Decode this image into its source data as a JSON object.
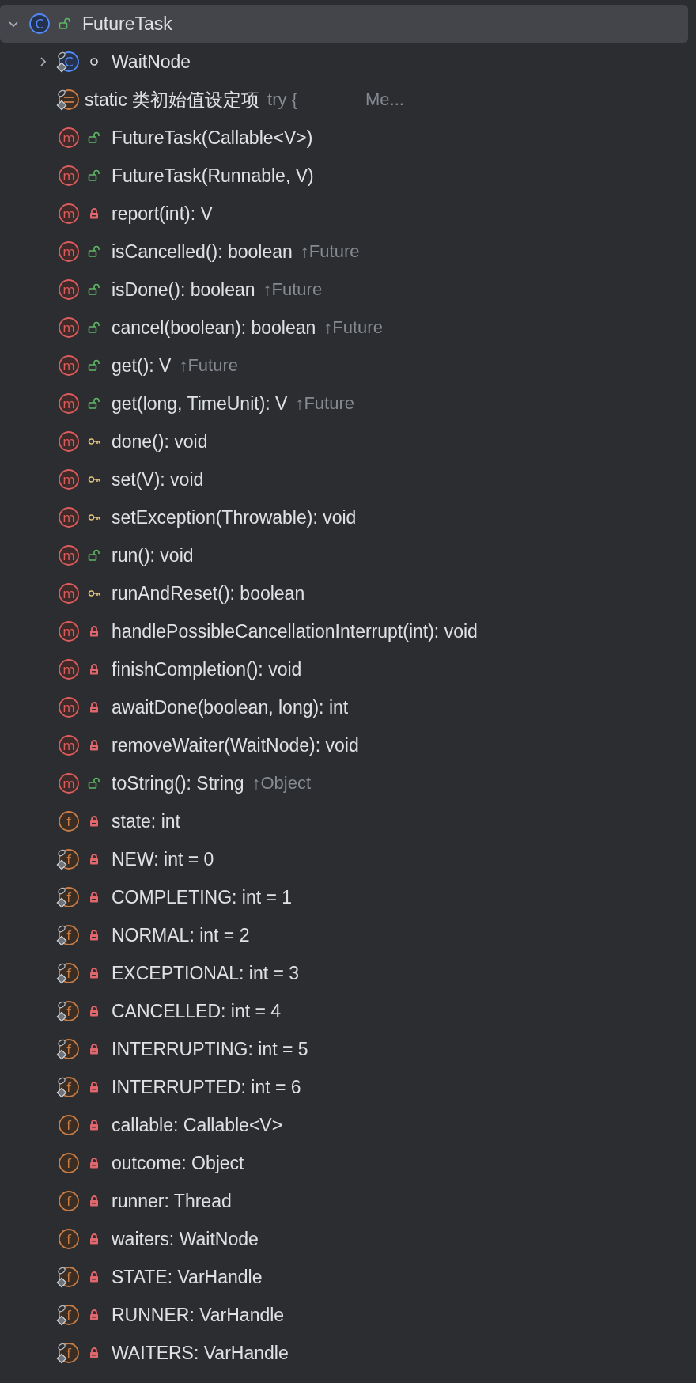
{
  "tree": {
    "name": "FutureTask",
    "kind": "class",
    "badge": "C",
    "modifier": {
      "kind": "public"
    },
    "expanded": true,
    "selected": true,
    "children": [
      {
        "name": "WaitNode",
        "kind": "class",
        "badge": "C",
        "modifier": {
          "kind": "package"
        },
        "static": true,
        "expanded": false,
        "selected": false
      },
      {
        "name": "static 类初始值设定项",
        "kind": "initializer",
        "static": true,
        "selected": false,
        "hint": "try {",
        "hint_2": "Me..."
      },
      {
        "name": "FutureTask(Callable<V>)",
        "kind": "method",
        "badge": "m",
        "modifier": {
          "kind": "public"
        },
        "selected": false
      },
      {
        "name": "FutureTask(Runnable, V)",
        "kind": "method",
        "badge": "m",
        "modifier": {
          "kind": "public"
        },
        "selected": false
      },
      {
        "name": "report(int): V",
        "kind": "method",
        "badge": "m",
        "modifier": {
          "kind": "private"
        },
        "selected": false
      },
      {
        "name": "isCancelled(): boolean",
        "kind": "method",
        "badge": "m",
        "modifier": {
          "kind": "public"
        },
        "selected": false,
        "hint": "↑Future"
      },
      {
        "name": "isDone(): boolean",
        "kind": "method",
        "badge": "m",
        "modifier": {
          "kind": "public"
        },
        "selected": false,
        "hint": "↑Future"
      },
      {
        "name": "cancel(boolean): boolean",
        "kind": "method",
        "badge": "m",
        "modifier": {
          "kind": "public"
        },
        "selected": false,
        "hint": "↑Future"
      },
      {
        "name": "get(): V",
        "kind": "method",
        "badge": "m",
        "modifier": {
          "kind": "public"
        },
        "selected": false,
        "hint": "↑Future"
      },
      {
        "name": "get(long, TimeUnit): V",
        "kind": "method",
        "badge": "m",
        "modifier": {
          "kind": "public"
        },
        "selected": false,
        "hint": "↑Future"
      },
      {
        "name": "done(): void",
        "kind": "method",
        "badge": "m",
        "modifier": {
          "kind": "protected"
        },
        "selected": false
      },
      {
        "name": "set(V): void",
        "kind": "method",
        "badge": "m",
        "modifier": {
          "kind": "protected"
        },
        "selected": false
      },
      {
        "name": "setException(Throwable): void",
        "kind": "method",
        "badge": "m",
        "modifier": {
          "kind": "protected"
        },
        "selected": false
      },
      {
        "name": "run(): void",
        "kind": "method",
        "badge": "m",
        "modifier": {
          "kind": "public"
        },
        "selected": false
      },
      {
        "name": "runAndReset(): boolean",
        "kind": "method",
        "badge": "m",
        "modifier": {
          "kind": "protected"
        },
        "selected": false
      },
      {
        "name": "handlePossibleCancellationInterrupt(int): void",
        "kind": "method",
        "badge": "m",
        "modifier": {
          "kind": "private"
        },
        "selected": false
      },
      {
        "name": "finishCompletion(): void",
        "kind": "method",
        "badge": "m",
        "modifier": {
          "kind": "private"
        },
        "selected": false
      },
      {
        "name": "awaitDone(boolean, long): int",
        "kind": "method",
        "badge": "m",
        "modifier": {
          "kind": "private"
        },
        "selected": false
      },
      {
        "name": "removeWaiter(WaitNode): void",
        "kind": "method",
        "badge": "m",
        "modifier": {
          "kind": "private"
        },
        "selected": false
      },
      {
        "name": "toString(): String",
        "kind": "method",
        "badge": "m",
        "modifier": {
          "kind": "public"
        },
        "selected": false,
        "hint": "↑Object"
      },
      {
        "name": "state: int",
        "kind": "field",
        "badge": "f",
        "modifier": {
          "kind": "private"
        },
        "selected": false
      },
      {
        "name": "NEW: int = 0",
        "kind": "field",
        "badge": "f",
        "modifier": {
          "kind": "private"
        },
        "static": true,
        "selected": false
      },
      {
        "name": "COMPLETING: int = 1",
        "kind": "field",
        "badge": "f",
        "modifier": {
          "kind": "private"
        },
        "static": true,
        "selected": false
      },
      {
        "name": "NORMAL: int = 2",
        "kind": "field",
        "badge": "f",
        "modifier": {
          "kind": "private"
        },
        "static": true,
        "selected": false
      },
      {
        "name": "EXCEPTIONAL: int = 3",
        "kind": "field",
        "badge": "f",
        "modifier": {
          "kind": "private"
        },
        "static": true,
        "selected": false
      },
      {
        "name": "CANCELLED: int = 4",
        "kind": "field",
        "badge": "f",
        "modifier": {
          "kind": "private"
        },
        "static": true,
        "selected": false
      },
      {
        "name": "INTERRUPTING: int = 5",
        "kind": "field",
        "badge": "f",
        "modifier": {
          "kind": "private"
        },
        "static": true,
        "selected": false
      },
      {
        "name": "INTERRUPTED: int = 6",
        "kind": "field",
        "badge": "f",
        "modifier": {
          "kind": "private"
        },
        "static": true,
        "selected": false
      },
      {
        "name": "callable: Callable<V>",
        "kind": "field",
        "badge": "f",
        "modifier": {
          "kind": "private"
        },
        "selected": false
      },
      {
        "name": "outcome: Object",
        "kind": "field",
        "badge": "f",
        "modifier": {
          "kind": "private"
        },
        "selected": false
      },
      {
        "name": "runner: Thread",
        "kind": "field",
        "badge": "f",
        "modifier": {
          "kind": "private"
        },
        "selected": false
      },
      {
        "name": "waiters: WaitNode",
        "kind": "field",
        "badge": "f",
        "modifier": {
          "kind": "private"
        },
        "selected": false
      },
      {
        "name": "STATE: VarHandle",
        "kind": "field",
        "badge": "f",
        "modifier": {
          "kind": "private"
        },
        "static": true,
        "selected": false
      },
      {
        "name": "RUNNER: VarHandle",
        "kind": "field",
        "badge": "f",
        "modifier": {
          "kind": "private"
        },
        "static": true,
        "selected": false
      },
      {
        "name": "WAITERS: VarHandle",
        "kind": "field",
        "badge": "f",
        "modifier": {
          "kind": "private"
        },
        "static": true,
        "selected": false
      }
    ]
  }
}
